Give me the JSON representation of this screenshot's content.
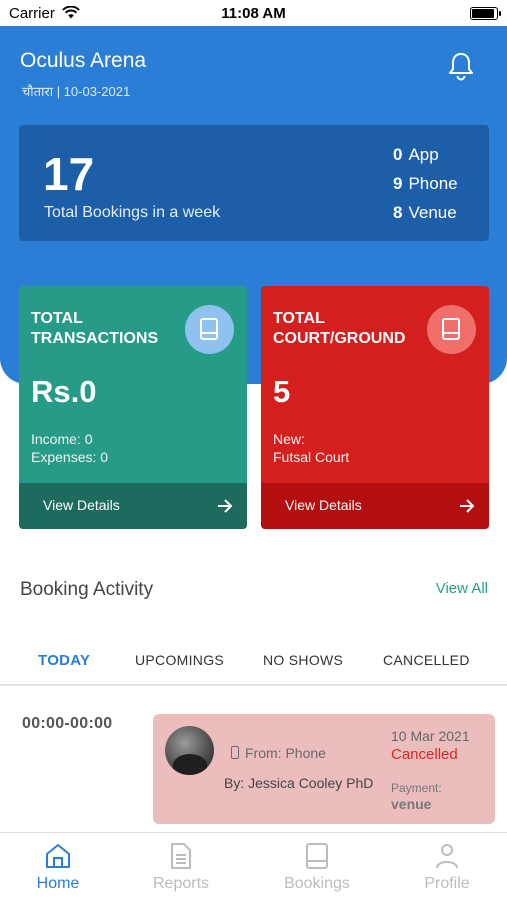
{
  "status_bar": {
    "carrier": "Carrier",
    "time": "11:08 AM",
    "battery_level": 0.95
  },
  "header": {
    "venue_name": "Oculus Arena",
    "subtitle": "चौतारा  | 10-03-2021"
  },
  "summary": {
    "count": "17",
    "label": "Total Bookings in a week",
    "rows": [
      {
        "value": "0",
        "label": "App"
      },
      {
        "value": "9",
        "label": "Phone"
      },
      {
        "value": "8",
        "label": "Venue"
      }
    ]
  },
  "transactions_card": {
    "title_line1": "TOTAL",
    "title_line2": "TRANSACTIONS",
    "value": "Rs.0",
    "detail_line1": "Income: 0",
    "detail_line2": "Expenses: 0",
    "footer": "View Details",
    "color": "#269b87",
    "icon": "book-icon"
  },
  "courts_card": {
    "title_line1": "TOTAL",
    "title_line2": "COURT/GROUND",
    "value": "5",
    "detail_line1": "New:",
    "detail_line2": "Futsal Court",
    "footer": "View Details",
    "color": "#d3201f",
    "icon": "book-icon"
  },
  "activity": {
    "title": "Booking Activity",
    "view_all": "View All",
    "tabs": [
      {
        "label": "TODAY",
        "active": true
      },
      {
        "label": "UPCOMINGS",
        "active": false
      },
      {
        "label": "NO SHOWS",
        "active": false
      },
      {
        "label": "CANCELLED",
        "active": false
      }
    ],
    "bookings": [
      {
        "time": "00:00-00:00",
        "from": "From: Phone",
        "by": "By: Jessica Cooley PhD",
        "date": "10 Mar 2021",
        "status": "Cancelled",
        "payment_label": "Payment:",
        "payment_value": "venue"
      }
    ]
  },
  "tab_bar": {
    "items": [
      {
        "label": "Home",
        "icon": "home-icon",
        "active": true
      },
      {
        "label": "Reports",
        "icon": "document-icon",
        "active": false
      },
      {
        "label": "Bookings",
        "icon": "book-icon",
        "active": false
      },
      {
        "label": "Profile",
        "icon": "person-icon",
        "active": false
      }
    ]
  },
  "colors": {
    "primary": "#2b7ed6",
    "accent": "#27a08a",
    "danger": "#e22424"
  }
}
